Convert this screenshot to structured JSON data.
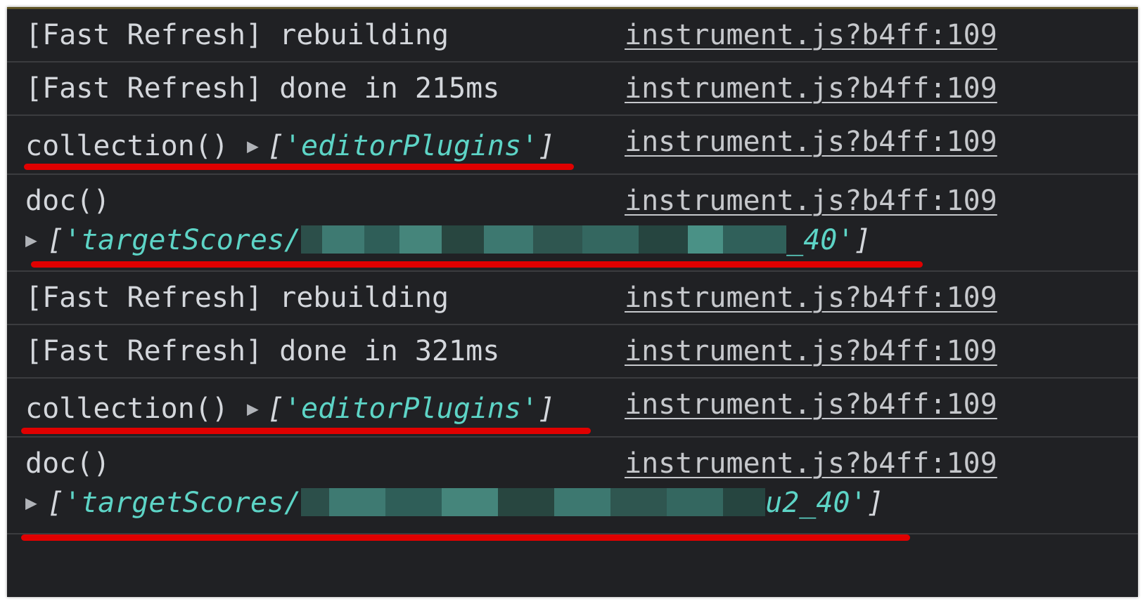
{
  "console": {
    "rows": [
      {
        "type": "text",
        "message": "[Fast Refresh] rebuilding",
        "source": "instrument.js?b4ff:109"
      },
      {
        "type": "text",
        "message": "[Fast Refresh] done in 215ms",
        "source": "instrument.js?b4ff:109"
      },
      {
        "type": "collection",
        "call": "collection()",
        "arg": "'editorPlugins'",
        "source": "instrument.js?b4ff:109"
      },
      {
        "type": "doc",
        "call": "doc()",
        "arg_prefix": "'targetScores/",
        "arg_suffix": "_40'",
        "source": "instrument.js?b4ff:109"
      },
      {
        "type": "text",
        "message": "[Fast Refresh] rebuilding",
        "source": "instrument.js?b4ff:109"
      },
      {
        "type": "text",
        "message": "[Fast Refresh] done in 321ms",
        "source": "instrument.js?b4ff:109"
      },
      {
        "type": "collection",
        "call": "collection()",
        "arg": "'editorPlugins'",
        "source": "instrument.js?b4ff:109"
      },
      {
        "type": "doc",
        "call": "doc()",
        "arg_prefix": "'targetScores/",
        "arg_suffix": "u2_40'",
        "source": "instrument.js?b4ff:109"
      }
    ],
    "glyphs": {
      "expand": "▶",
      "open_bracket": "[",
      "close_bracket": "]"
    }
  },
  "colors": {
    "background": "#202124",
    "text": "#d4d7dc",
    "string": "#5dd4c6",
    "annotation": "#e00000"
  },
  "icons": {
    "expand": "triangle-right-icon"
  }
}
